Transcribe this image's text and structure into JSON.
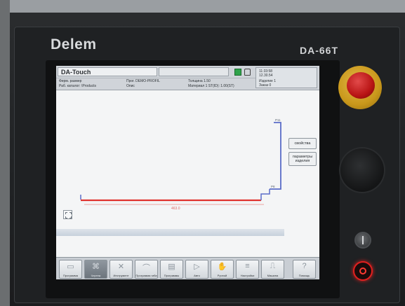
{
  "machine": {
    "brand": "Delem",
    "model": "DA-66T"
  },
  "header": {
    "app_title": "DA-Touch",
    "row1": {
      "field_a": "Фирм. размер",
      "field_b": "Прог. DEMO-PROFIL",
      "field_c": "Толщина 1.50"
    },
    "row2": {
      "field_a": "Раб. каталог: \\Products",
      "field_b": "Опис",
      "field_c": "Материал 1 ST(ID): 1.00(ST)"
    },
    "clock": {
      "time": "11:33:58",
      "date": "12.30.54",
      "line3": "Изделие 1",
      "line4": "Заказ 0"
    }
  },
  "drawing": {
    "dimension_label": "463.0",
    "tag_top": "P11",
    "tag_bottom": "P8",
    "colors": {
      "profile_main": "#e0322e",
      "profile_wall": "#5a6cc8"
    }
  },
  "side_buttons": {
    "properties": "свойства",
    "product_params": "параметры изделия"
  },
  "toolbar": {
    "buttons": [
      {
        "label": "Программа",
        "icon": "folder-icon"
      },
      {
        "label": "Чертеж",
        "icon": "draw-icon"
      },
      {
        "label": "Инструмент",
        "icon": "tool-icon"
      },
      {
        "label": "Программа гиба",
        "icon": "bend-icon"
      },
      {
        "label": "Программы",
        "icon": "programs-icon"
      },
      {
        "label": "Авто",
        "icon": "play-icon"
      },
      {
        "label": "Ручной",
        "icon": "hand-icon"
      },
      {
        "label": "Настройки",
        "icon": "settings-icon"
      },
      {
        "label": "Машина",
        "icon": "machine-icon"
      },
      {
        "label": "Помощь",
        "icon": "help-icon"
      }
    ]
  }
}
